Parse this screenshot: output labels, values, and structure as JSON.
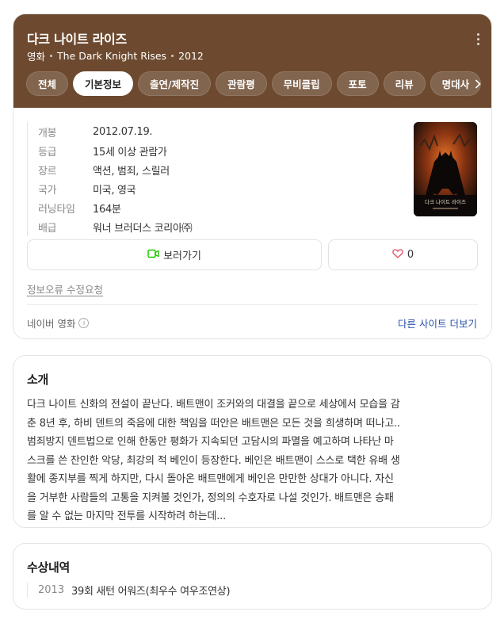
{
  "colors": {
    "header_bg": "#6d4a2f",
    "link": "#2a4fa7",
    "watch_icon": "#1ec800",
    "heart_icon": "#e5566a"
  },
  "header": {
    "title": "다크 나이트 라이즈",
    "category": "영화",
    "original_title": "The Dark Knight Rises",
    "year": "2012"
  },
  "tabs": [
    {
      "label": "전체"
    },
    {
      "label": "기본정보"
    },
    {
      "label": "출연/제작진"
    },
    {
      "label": "관람평"
    },
    {
      "label": "무비클립"
    },
    {
      "label": "포토"
    },
    {
      "label": "리뷰"
    },
    {
      "label": "명대사"
    }
  ],
  "active_tab": "기본정보",
  "info": [
    {
      "label": "개봉",
      "value": "2012.07.19."
    },
    {
      "label": "등급",
      "value": "15세 이상 관람가"
    },
    {
      "label": "장르",
      "value": "액션, 범죄, 스릴러"
    },
    {
      "label": "국가",
      "value": "미국, 영국"
    },
    {
      "label": "러닝타임",
      "value": "164분"
    },
    {
      "label": "배급",
      "value": "워너 브러더스 코리아㈜"
    }
  ],
  "poster": {
    "title_text": "다크 나이트 라이즈",
    "icon": "movie-poster"
  },
  "buttons": {
    "watch_label": "보러가기",
    "watch_icon": "play-video-icon",
    "like_count": "0",
    "like_icon": "heart-outline-icon"
  },
  "report_link": "정보오류 수정요청",
  "footer": {
    "source": "네이버 영화",
    "other_sites": "다른 사이트 더보기"
  },
  "intro": {
    "title": "소개",
    "lines": [
      "다크 나이트 신화의 전설이 끝난다. 배트맨이 조커와의 대결을 끝으로 세상에서 모습을 감",
      "춘 8년 후, 하비 덴트의 죽음에 대한 책임을 떠안은 배트맨은 모든 것을 희생하며 떠나고..",
      "범죄방지 덴트법으로 인해 한동안 평화가 지속되던 고담시의 파멸을 예고하며 나타난 마",
      "스크를 쓴 잔인한 악당, 최강의 적 베인이 등장한다. 베인은 배트맨이 스스로 택한 유배 생",
      "활에 종지부를 찍게 하지만, 다시 돌아온 배트맨에게 베인은 만만한 상대가 아니다. 자신",
      "을 거부한 사람들의 고통을 지켜볼 것인가, 정의의 수호자로 나설 것인가. 배트맨은 승패",
      "를 알 수 없는 마지막 전투를 시작하려 하는데..."
    ]
  },
  "awards": {
    "title": "수상내역",
    "items": [
      {
        "year": "2013",
        "text": "39회 새턴 어워즈(최우수 여우조연상)"
      }
    ]
  }
}
